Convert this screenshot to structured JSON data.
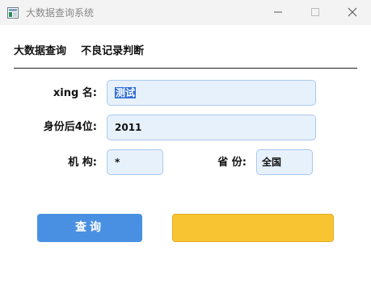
{
  "window": {
    "title": "大数据查询系统"
  },
  "menu": {
    "items": [
      "大数据查询",
      "不良记录判断"
    ]
  },
  "form": {
    "name_label": "xing 名:",
    "name_value": "测试",
    "id_label": "身份后4位:",
    "id_value": "2011",
    "org_label": "机 构:",
    "org_value": "*",
    "province_label": "省 份:",
    "province_value": "全国"
  },
  "actions": {
    "query_label": "查询",
    "secondary_label": ""
  },
  "colors": {
    "query_button": "#4a90e2",
    "secondary_button": "#f8c432",
    "field_background": "#e7f1fc",
    "field_border": "#a9c9ee"
  }
}
